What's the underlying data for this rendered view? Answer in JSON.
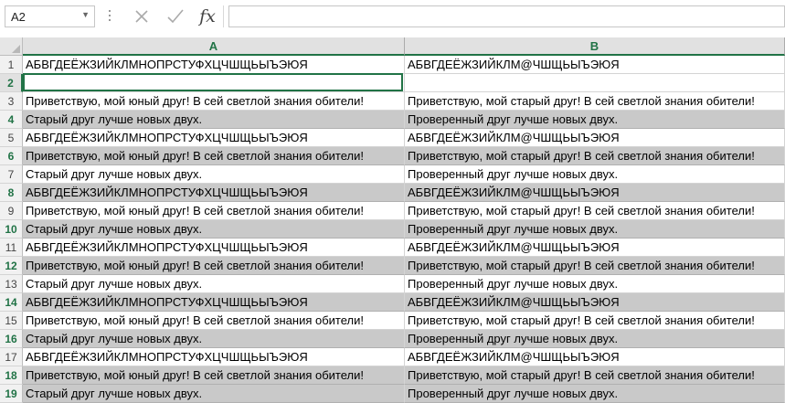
{
  "formula_bar": {
    "name_box": "A2",
    "formula": "",
    "fx_label": "fx"
  },
  "columns": [
    "A",
    "B"
  ],
  "rows": [
    {
      "num": "1",
      "a": "АБВГДЕЁЖЗИЙКЛМНОПРСТУФХЦЧШЩЬЫЪЭЮЯ",
      "b": "АБВГДЕЁЖЗИЙКЛМ@ЧШЩЬЫЪЭЮЯ",
      "gray": false
    },
    {
      "num": "2",
      "a": "",
      "b": "",
      "gray": false
    },
    {
      "num": "3",
      "a": "Приветствую, мой юный друг! В сей светлой знания обители!",
      "b": "Приветствую, мой старый друг! В сей светлой знания обители!",
      "gray": false
    },
    {
      "num": "4",
      "a": "Старый друг лучше новых двух.",
      "b": "Проверенный друг лучше новых двух.",
      "gray": true
    },
    {
      "num": "5",
      "a": "АБВГДЕЁЖЗИЙКЛМНОПРСТУФХЦЧШЩЬЫЪЭЮЯ",
      "b": "АБВГДЕЁЖЗИЙКЛМ@ЧШЩЬЫЪЭЮЯ",
      "gray": false
    },
    {
      "num": "6",
      "a": "Приветствую, мой юный друг! В сей светлой знания обители!",
      "b": "Приветствую, мой старый друг! В сей светлой знания обители!",
      "gray": true
    },
    {
      "num": "7",
      "a": "Старый друг лучше новых двух.",
      "b": "Проверенный друг лучше новых двух.",
      "gray": false
    },
    {
      "num": "8",
      "a": "АБВГДЕЁЖЗИЙКЛМНОПРСТУФХЦЧШЩЬЫЪЭЮЯ",
      "b": "АБВГДЕЁЖЗИЙКЛМ@ЧШЩЬЫЪЭЮЯ",
      "gray": true
    },
    {
      "num": "9",
      "a": "Приветствую, мой юный друг! В сей светлой знания обители!",
      "b": "Приветствую, мой старый друг! В сей светлой знания обители!",
      "gray": false
    },
    {
      "num": "10",
      "a": "Старый друг лучше новых двух.",
      "b": "Проверенный друг лучше новых двух.",
      "gray": true
    },
    {
      "num": "11",
      "a": "АБВГДЕЁЖЗИЙКЛМНОПРСТУФХЦЧШЩЬЫЪЭЮЯ",
      "b": "АБВГДЕЁЖЗИЙКЛМ@ЧШЩЬЫЪЭЮЯ",
      "gray": false
    },
    {
      "num": "12",
      "a": "Приветствую, мой юный друг! В сей светлой знания обители!",
      "b": "Приветствую, мой старый друг! В сей светлой знания обители!",
      "gray": true
    },
    {
      "num": "13",
      "a": "Старый друг лучше новых двух.",
      "b": "Проверенный друг лучше новых двух.",
      "gray": false
    },
    {
      "num": "14",
      "a": "АБВГДЕЁЖЗИЙКЛМНОПРСТУФХЦЧШЩЬЫЪЭЮЯ",
      "b": "АБВГДЕЁЖЗИЙКЛМ@ЧШЩЬЫЪЭЮЯ",
      "gray": true
    },
    {
      "num": "15",
      "a": "Приветствую, мой юный друг! В сей светлой знания обители!",
      "b": "Приветствую, мой старый друг! В сей светлой знания обители!",
      "gray": false
    },
    {
      "num": "16",
      "a": "Старый друг лучше новых двух.",
      "b": "Проверенный друг лучше новых двух.",
      "gray": true
    },
    {
      "num": "17",
      "a": "АБВГДЕЁЖЗИЙКЛМНОПРСТУФХЦЧШЩЬЫЪЭЮЯ",
      "b": "АБВГДЕЁЖЗИЙКЛМ@ЧШЩЬЫЪЭЮЯ",
      "gray": false
    },
    {
      "num": "18",
      "a": "Приветствую, мой юный друг! В сей светлой знания обители!",
      "b": "Приветствую, мой старый друг! В сей светлой знания обители!",
      "gray": true
    },
    {
      "num": "19",
      "a": "Старый друг лучше новых двух.",
      "b": "Проверенный друг лучше новых двух.",
      "gray": true
    }
  ],
  "selection": {
    "row": "2",
    "column": "A"
  },
  "colors": {
    "accent": "#217346",
    "row_fill": "#c9c9c9"
  }
}
